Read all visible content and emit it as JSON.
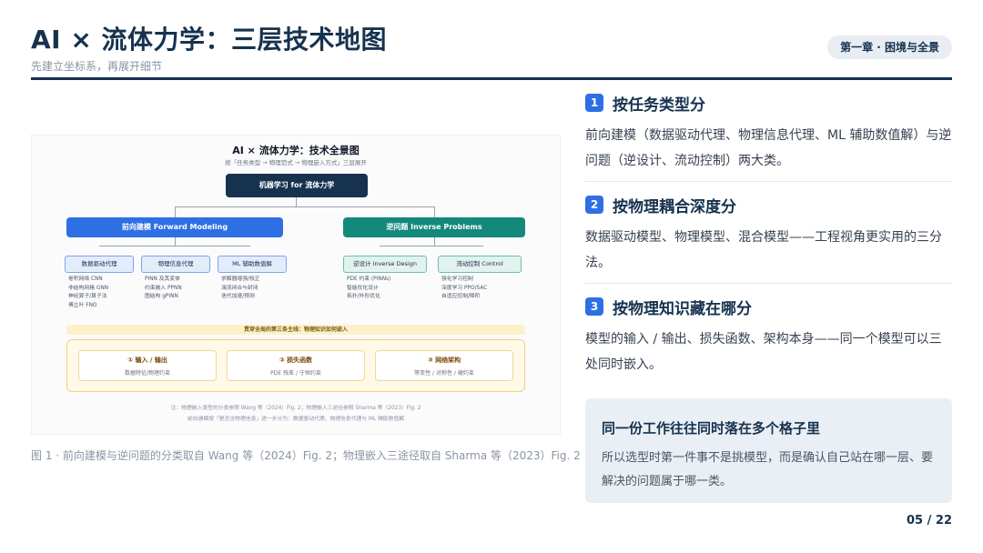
{
  "header": {
    "title": "AI × 流体力学：三层技术地图",
    "subtitle": "先建立坐标系，再展开细节",
    "chapter": "第一章 · 困境与全景"
  },
  "figure": {
    "title": "AI × 流体力学：技术全景图",
    "subtitle": "按「任务类型 → 物理范式 → 物理嵌入方式」三层展开",
    "root": "机器学习 for 流体力学",
    "forward": {
      "label": "前向建模 Forward Modeling",
      "cards": [
        {
          "label": "数据驱动代理",
          "items": [
            "卷积网络 CNN",
            "非结构网格 GNN",
            "神经算子/算子法",
            "傅立叶 FNO"
          ]
        },
        {
          "label": "物理信息代理",
          "items": [
            "PINN 及其变体",
            "约束嵌入 PPNN",
            "图结构 gPINN"
          ]
        },
        {
          "label": "ML 辅助数值解",
          "items": [
            "求解器增强/校正",
            "湍流闭合与封闭",
            "迭代加速/预测"
          ]
        }
      ]
    },
    "inverse": {
      "label": "逆问题 Inverse Problems",
      "cards": [
        {
          "label": "逆设计 Inverse Design",
          "items": [
            "PDE 约束 (PINNs)",
            "智能优化设计",
            "拓扑/外形优化"
          ]
        },
        {
          "label": "流动控制 Control",
          "items": [
            "强化学习控制",
            "深度学习 PPO/SAC",
            "自适应控制/降阶"
          ]
        }
      ]
    },
    "band": "贯穿全局的第三条主线：物理知识如何嵌入",
    "ways": [
      {
        "title": "① 输入 / 输出",
        "desc": "数据特征/物理约束"
      },
      {
        "title": "② 损失函数",
        "desc": "PDE 残差 / 守恒约束"
      },
      {
        "title": "③ 网络架构",
        "desc": "等变性 / 对称性 / 硬约束"
      }
    ],
    "note1": "注：物理嵌入类型的分类参照 Wang 等（2024）Fig. 2；物理嵌入三途径参照 Sharma 等（2023）Fig. 2",
    "note2": "前向建模按「是否含物理信息」进一步分为：数据驱动代理、物理信息代理与 ML 辅助数值解"
  },
  "caption": "图 1 · 前向建模与逆问题的分类取自 Wang 等（2024）Fig. 2；物理嵌入三途径取自 Sharma 等（2023）Fig. 2",
  "sections": [
    {
      "num": "1",
      "title": "按任务类型分",
      "body": "前向建模（数据驱动代理、物理信息代理、ML 辅助数值解）与逆问题（逆设计、流动控制）两大类。"
    },
    {
      "num": "2",
      "title": "按物理耦合深度分",
      "body": "数据驱动模型、物理模型、混合模型——工程视角更实用的三分法。"
    },
    {
      "num": "3",
      "title": "按物理知识藏在哪分",
      "body": "模型的输入 / 输出、损失函数、架构本身——同一个模型可以三处同时嵌入。"
    }
  ],
  "callout": {
    "title": "同一份工作往往同时落在多个格子里",
    "body": "所以选型时第一件事不是挑模型，而是确认自己站在哪一层、要解决的问题属于哪一类。"
  },
  "page_number": "05 / 22",
  "colors": {
    "navy": "#16324f",
    "accent_blue": "#2f6fe4",
    "teal": "#13897c",
    "callout_bg": "#eaeff5"
  }
}
